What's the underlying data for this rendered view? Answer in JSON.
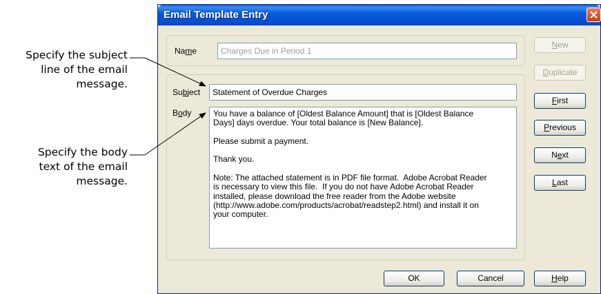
{
  "callouts": {
    "subject": [
      "Specify the subject",
      "line of the email",
      "message."
    ],
    "body": [
      "Specify the body",
      "text of the email",
      "message."
    ]
  },
  "window": {
    "title": "Email Template Entry"
  },
  "form": {
    "name_label_pre": "Na",
    "name_label_ul": "m",
    "name_label_post": "e",
    "name_value": "Charges Due in Period 1",
    "subject_label_pre": "Su",
    "subject_label_ul": "b",
    "subject_label_post": "ject",
    "subject_value": "Statement of Overdue Charges",
    "body_label_pre": "B",
    "body_label_ul": "o",
    "body_label_post": "dy",
    "body_value": "You have a balance of [Oldest Balance Amount] that is [Oldest Balance\nDays] days overdue. Your total balance is [New Balance].\n\nPlease submit a payment.\n\nThank you.\n\nNote: The attached statement is in PDF file format.  Adobe Acrobat Reader\nis necessary to view this file.  If you do not have Adobe Acrobat Reader\ninstalled, please download the free reader from the Adobe website\n(http://www.adobe.com/products/acrobat/readstep2.html) and install it on\nyour computer."
  },
  "buttons": {
    "new_ul": "N",
    "new_rest": "ew",
    "duplicate_ul": "D",
    "duplicate_rest": "uplicate",
    "first_ul": "F",
    "first_rest": "irst",
    "previous_ul": "P",
    "previous_rest": "revious",
    "next_pre": "N",
    "next_ul": "e",
    "next_rest": "xt",
    "last_ul": "L",
    "last_rest": "ast",
    "ok": "OK",
    "cancel": "Cancel",
    "help_ul": "H",
    "help_rest": "elp"
  },
  "colors": {
    "titlebar": "#0a5fdc",
    "dialog_bg": "#ece9d8",
    "close_button": "#c63b14"
  }
}
